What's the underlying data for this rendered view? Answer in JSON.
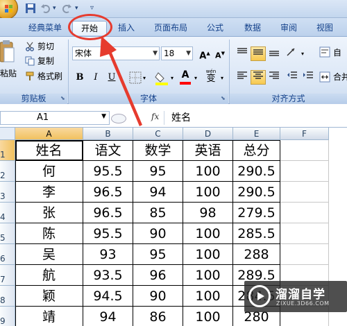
{
  "ribbon_tabs": [
    {
      "label": "经典菜单",
      "active": false
    },
    {
      "label": "开始",
      "active": true
    },
    {
      "label": "插入",
      "active": false
    },
    {
      "label": "页面布局",
      "active": false
    },
    {
      "label": "公式",
      "active": false
    },
    {
      "label": "数据",
      "active": false
    },
    {
      "label": "审阅",
      "active": false
    },
    {
      "label": "视图",
      "active": false
    }
  ],
  "clipboard": {
    "paste_label": "粘贴",
    "cut_label": "剪切",
    "copy_label": "复制",
    "format_painter_label": "格式刷",
    "group_label": "剪贴板"
  },
  "font": {
    "font_name": "宋体",
    "font_size": "18",
    "bold": "B",
    "italic": "I",
    "underline": "U",
    "grow_label": "A",
    "shrink_label": "A",
    "phonetic_label": "wén",
    "char_label": "变",
    "group_label": "字体"
  },
  "alignment": {
    "wrap_label": "自",
    "merge_label": "合并",
    "group_label": "对齐方式"
  },
  "formula_bar": {
    "name_box": "A1",
    "fx_label": "fx",
    "formula": "姓名"
  },
  "grid": {
    "columns": [
      "A",
      "B",
      "C",
      "D",
      "E",
      "F"
    ],
    "row_numbers": [
      "1",
      "2",
      "3",
      "4",
      "5",
      "6",
      "7",
      "8",
      "9"
    ],
    "rows": [
      [
        "姓名",
        "语文",
        "数学",
        "英语",
        "总分"
      ],
      [
        "何",
        "95.5",
        "95",
        "100",
        "290.5"
      ],
      [
        "李",
        "96.5",
        "94",
        "100",
        "290.5"
      ],
      [
        "张",
        "96.5",
        "85",
        "98",
        "279.5"
      ],
      [
        "陈",
        "95.5",
        "90",
        "100",
        "285.5"
      ],
      [
        "吴",
        "93",
        "95",
        "100",
        "288"
      ],
      [
        "航",
        "93.5",
        "96",
        "100",
        "289.5"
      ],
      [
        "颖",
        "94.5",
        "90",
        "100",
        "284.5"
      ],
      [
        "靖",
        "94",
        "86",
        "100",
        "280"
      ]
    ]
  },
  "watermark": {
    "title": "溜溜自学",
    "url": "ZIXUE.3D66.COM"
  },
  "colors": {
    "annotation_red": "#e63b2e",
    "ribbon_text": "#15428b"
  }
}
